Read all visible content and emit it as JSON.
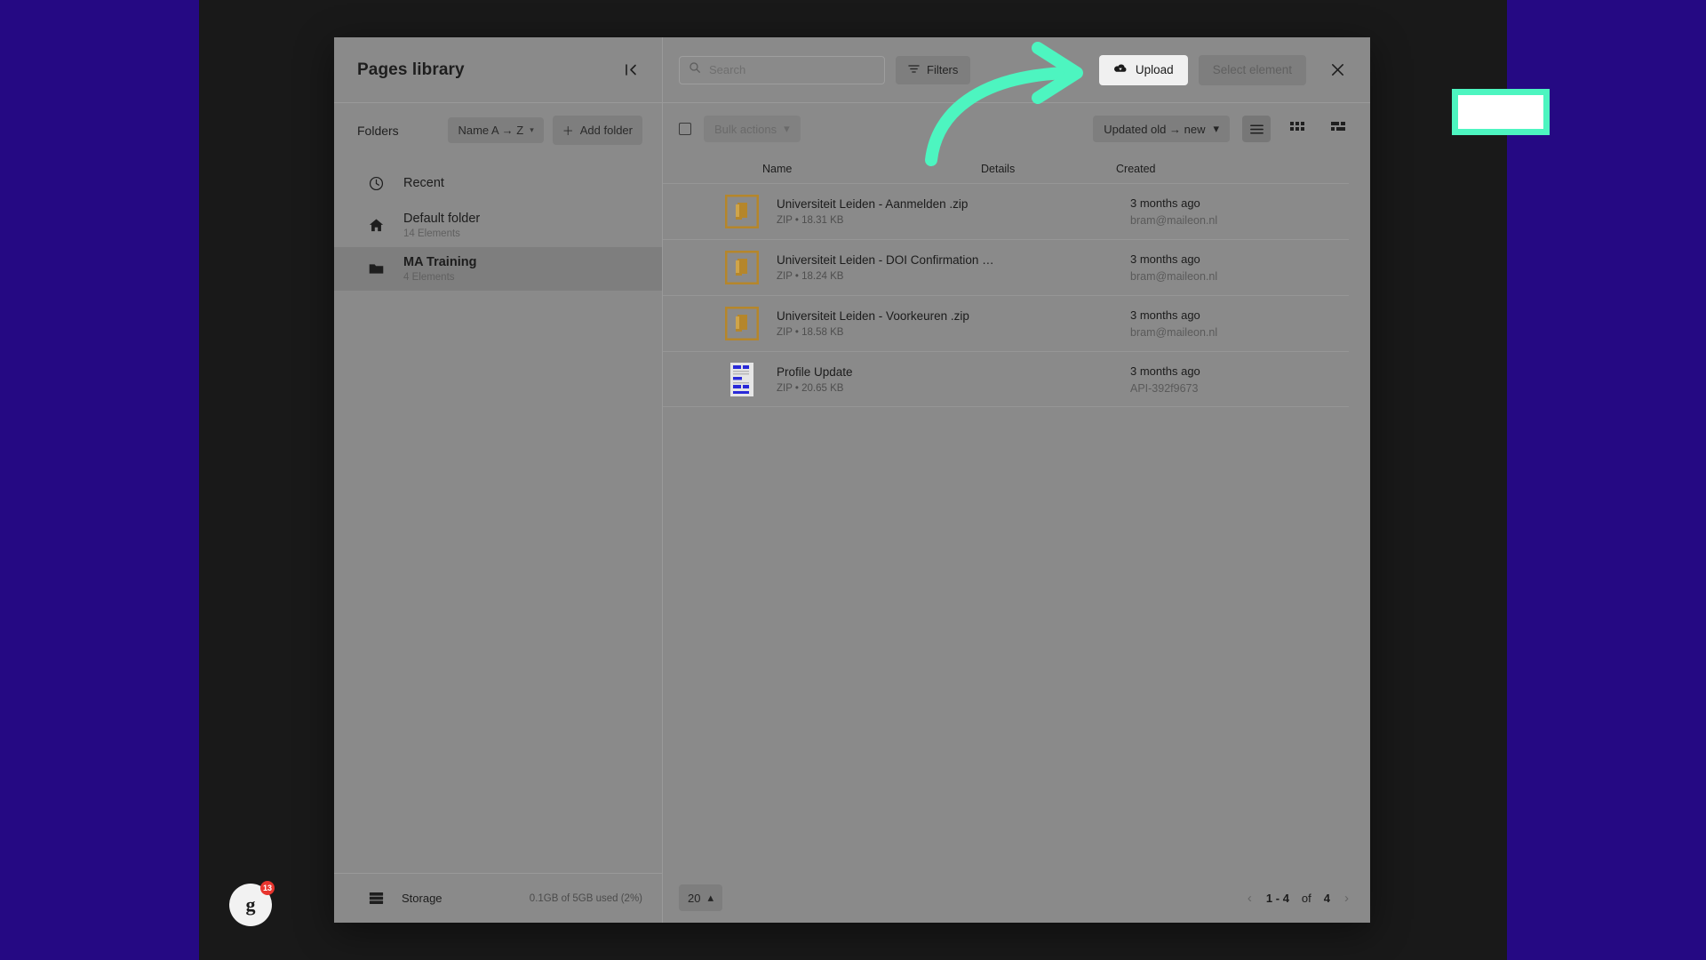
{
  "sidebar": {
    "title": "Pages library",
    "collapse_icon": "collapse-panel-icon",
    "folders_label": "Folders",
    "sort_pill": "Name A → Z",
    "add_folder": "Add folder",
    "items": [
      {
        "name": "Recent",
        "sub": "",
        "icon": "clock-icon",
        "active": false
      },
      {
        "name": "Default folder",
        "sub": "14 Elements",
        "icon": "home-icon",
        "active": false
      },
      {
        "name": "MA Training",
        "sub": "4 Elements",
        "icon": "folder-icon",
        "active": true
      }
    ],
    "storage_label": "Storage",
    "storage_used": "0.1GB of 5GB used (2%)"
  },
  "header": {
    "search_placeholder": "Search",
    "search_value": "",
    "filters_label": "Filters",
    "upload_label": "Upload",
    "select_element_label": "Select element",
    "close_icon": "close-icon"
  },
  "toolbar": {
    "bulk_actions_label": "Bulk actions",
    "sort_label": "Updated old → new",
    "views": [
      {
        "icon": "list-view-icon",
        "active": true
      },
      {
        "icon": "grid-view-icon",
        "active": false
      },
      {
        "icon": "mosaic-view-icon",
        "active": false
      }
    ]
  },
  "table": {
    "columns": [
      "Name",
      "Details",
      "Created"
    ],
    "rows": [
      {
        "name": "Universiteit Leiden - Aanmelden .zip",
        "meta": "ZIP • 18.31 KB",
        "details": "",
        "created": "3 months ago",
        "created_by": "bram@maileon.nl",
        "thumb": "zip-file-icon"
      },
      {
        "name": "Universiteit Leiden - DOI Confirmation …",
        "meta": "ZIP • 18.24 KB",
        "details": "",
        "created": "3 months ago",
        "created_by": "bram@maileon.nl",
        "thumb": "zip-file-icon"
      },
      {
        "name": "Universiteit Leiden - Voorkeuren .zip",
        "meta": "ZIP • 18.58 KB",
        "details": "",
        "created": "3 months ago",
        "created_by": "bram@maileon.nl",
        "thumb": "zip-file-icon"
      },
      {
        "name": "Profile Update",
        "meta": "ZIP • 20.65 KB",
        "details": "",
        "created": "3 months ago",
        "created_by": "API-392f9673",
        "thumb": "document-preview-icon"
      }
    ]
  },
  "footer": {
    "per_page": "20",
    "page_range": "1 - 4",
    "of_label": "of",
    "total": "4"
  },
  "badge": {
    "letter": "g",
    "count": "13"
  },
  "colors": {
    "accent_highlight": "#4df5c0",
    "modal_bg": "#8a8a8a",
    "backdrop": "#4411ee",
    "zip_icon": "#b5862b"
  }
}
